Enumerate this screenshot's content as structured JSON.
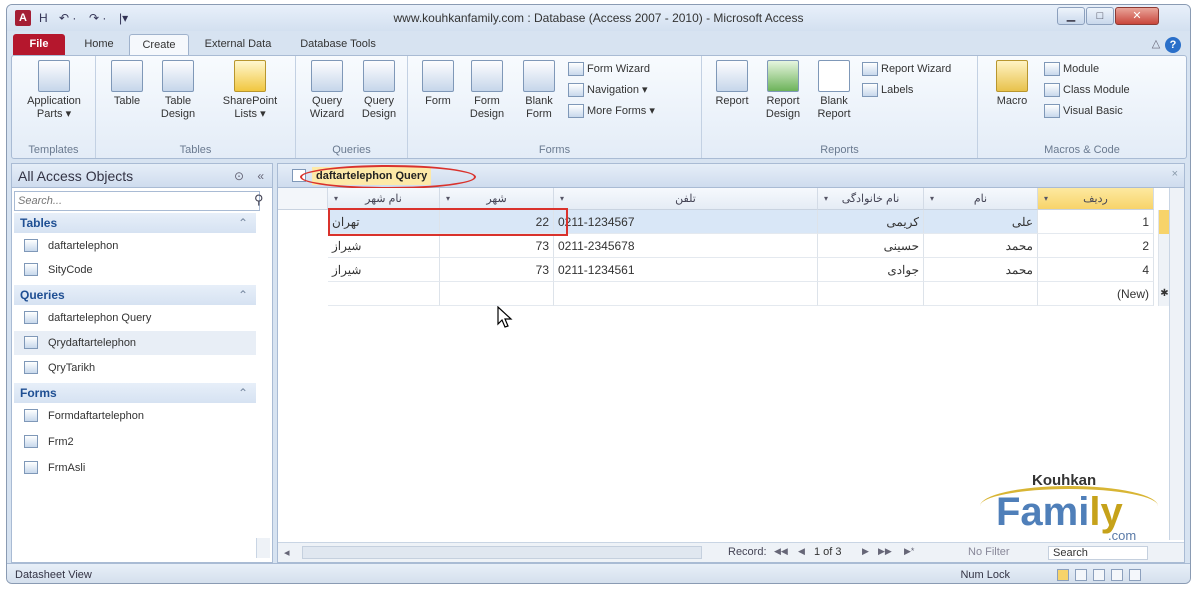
{
  "title": "www.kouhkanfamily.com : Database (Access 2007 - 2010)  -  Microsoft Access",
  "quick_access": {
    "app_icon": "A",
    "save": "H",
    "undo": "↶ ·",
    "redo": "↷ ·",
    "customize": "|▾"
  },
  "window_controls": {
    "minimize": "▁",
    "maximize": "□",
    "close": "✕"
  },
  "ribbon_tabs": [
    "File",
    "Home",
    "Create",
    "External Data",
    "Database Tools"
  ],
  "ribbon_right": {
    "collapse": "△",
    "help": "?"
  },
  "groups": {
    "templates": {
      "label": "Templates",
      "app_parts": "Application\nParts ▾"
    },
    "tables": {
      "label": "Tables",
      "table": "Table",
      "table_design": "Table\nDesign",
      "sharepoint": "SharePoint\nLists ▾"
    },
    "queries": {
      "label": "Queries",
      "wizard": "Query\nWizard",
      "design": "Query\nDesign"
    },
    "forms": {
      "label": "Forms",
      "form": "Form",
      "form_design": "Form\nDesign",
      "blank_form": "Blank\nForm",
      "form_wizard": "Form Wizard",
      "navigation": "Navigation ▾",
      "more_forms": "More Forms ▾"
    },
    "reports": {
      "label": "Reports",
      "report": "Report",
      "report_design": "Report\nDesign",
      "blank_report": "Blank\nReport",
      "report_wizard": "Report Wizard",
      "labels": "Labels"
    },
    "macros": {
      "label": "Macros & Code",
      "macro": "Macro",
      "module": "Module",
      "class_module": "Class Module",
      "visual_basic": "Visual Basic"
    }
  },
  "nav": {
    "header": "All Access Objects",
    "header_menu": "⊙",
    "header_collapse": "«",
    "search_placeholder": "Search...",
    "search_icon": "⚲",
    "sections": [
      {
        "label": "Tables",
        "chevron": "⌃",
        "items": [
          "daftartelephon",
          "SityCode"
        ]
      },
      {
        "label": "Queries",
        "chevron": "⌃",
        "items": [
          "daftartelephon Query",
          "Qrydaftartelephon",
          "QryTarikh"
        ]
      },
      {
        "label": "Forms",
        "chevron": "⌃",
        "items": [
          "Formdaftartelephon",
          "Frm2",
          "FrmAsli"
        ]
      }
    ]
  },
  "doc_tab": {
    "label": "daftartelephon Query",
    "close": "×"
  },
  "grid": {
    "headers": [
      "نام شهر",
      "شهر",
      "تلفن",
      "نام خانوادگی",
      "نام",
      "ردیف"
    ],
    "rows": [
      [
        "تهران",
        "22",
        "0211-1234567",
        "کریمی",
        "علی",
        "1"
      ],
      [
        "شیراز",
        "73",
        "0211-2345678",
        "حسینی",
        "محمد",
        "2"
      ],
      [
        "شیراز",
        "73",
        "0211-1234561",
        "جوادی",
        "محمد",
        "4"
      ],
      [
        "",
        "",
        "",
        "",
        "",
        "(New)"
      ]
    ]
  },
  "record_nav": {
    "label": "Record:",
    "first": "◀◀",
    "prev": "◀",
    "position": "1 of 3",
    "next": "▶",
    "last": "▶▶",
    "new": "▶*",
    "filter": "No Filter",
    "search": "Search"
  },
  "logo": {
    "top": "Kouhkan",
    "main": "Fami",
    "y": "ly",
    "com": ".com"
  },
  "status": {
    "left": "Datasheet View",
    "num_lock": "Num Lock"
  }
}
